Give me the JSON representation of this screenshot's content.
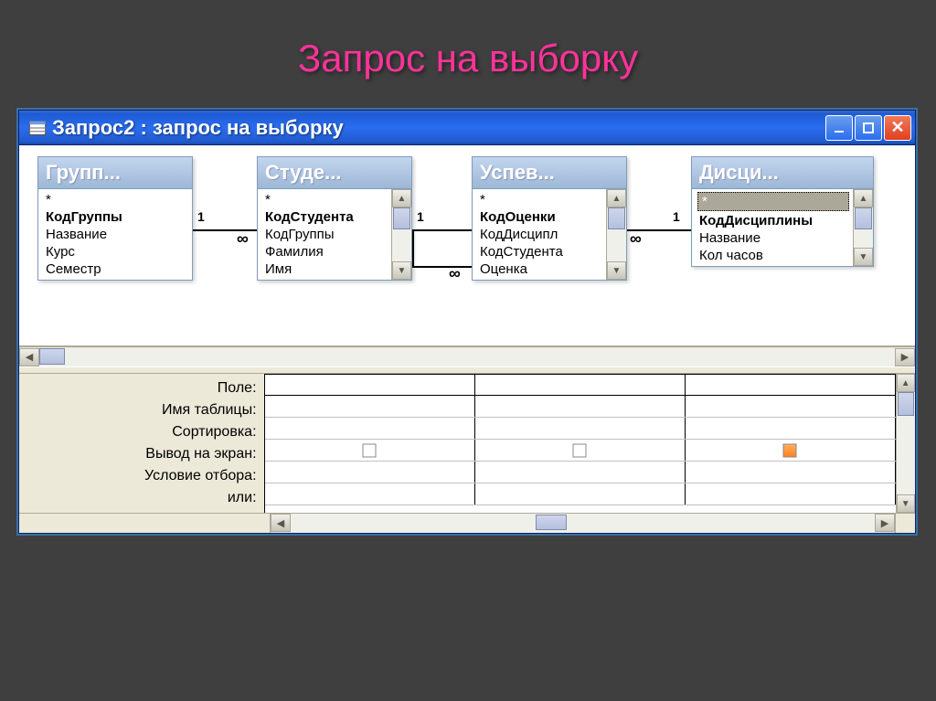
{
  "slide_title": "Запрос на выборку",
  "window": {
    "title": "Запрос2 : запрос на выборку"
  },
  "tables": [
    {
      "header": "Групп...",
      "fields": [
        {
          "text": "*",
          "bold": false
        },
        {
          "text": "КодГруппы",
          "bold": true
        },
        {
          "text": "Название",
          "bold": false
        },
        {
          "text": "Курс",
          "bold": false
        },
        {
          "text": "Семестр",
          "bold": false
        }
      ]
    },
    {
      "header": "Студе...",
      "fields": [
        {
          "text": "*",
          "bold": false
        },
        {
          "text": "КодСтудента",
          "bold": true
        },
        {
          "text": "КодГруппы",
          "bold": false
        },
        {
          "text": "Фамилия",
          "bold": false
        },
        {
          "text": "Имя",
          "bold": false
        }
      ]
    },
    {
      "header": "Успев...",
      "fields": [
        {
          "text": "*",
          "bold": false
        },
        {
          "text": "КодОценки",
          "bold": true
        },
        {
          "text": "КодДисципл",
          "bold": false
        },
        {
          "text": "КодСтудента",
          "bold": false
        },
        {
          "text": "Оценка",
          "bold": false
        }
      ]
    },
    {
      "header": "Дисци...",
      "fields": [
        {
          "text": "*",
          "bold": false,
          "selected": true
        },
        {
          "text": "КодДисциплины",
          "bold": true
        },
        {
          "text": "Название",
          "bold": false
        },
        {
          "text": "Кол часов",
          "bold": false
        }
      ]
    }
  ],
  "relations": {
    "one": "1",
    "many": "∞"
  },
  "grid": {
    "labels": [
      "Поле:",
      "Имя таблицы:",
      "Сортировка:",
      "Вывод на экран:",
      "Условие отбора:",
      "или:"
    ]
  }
}
